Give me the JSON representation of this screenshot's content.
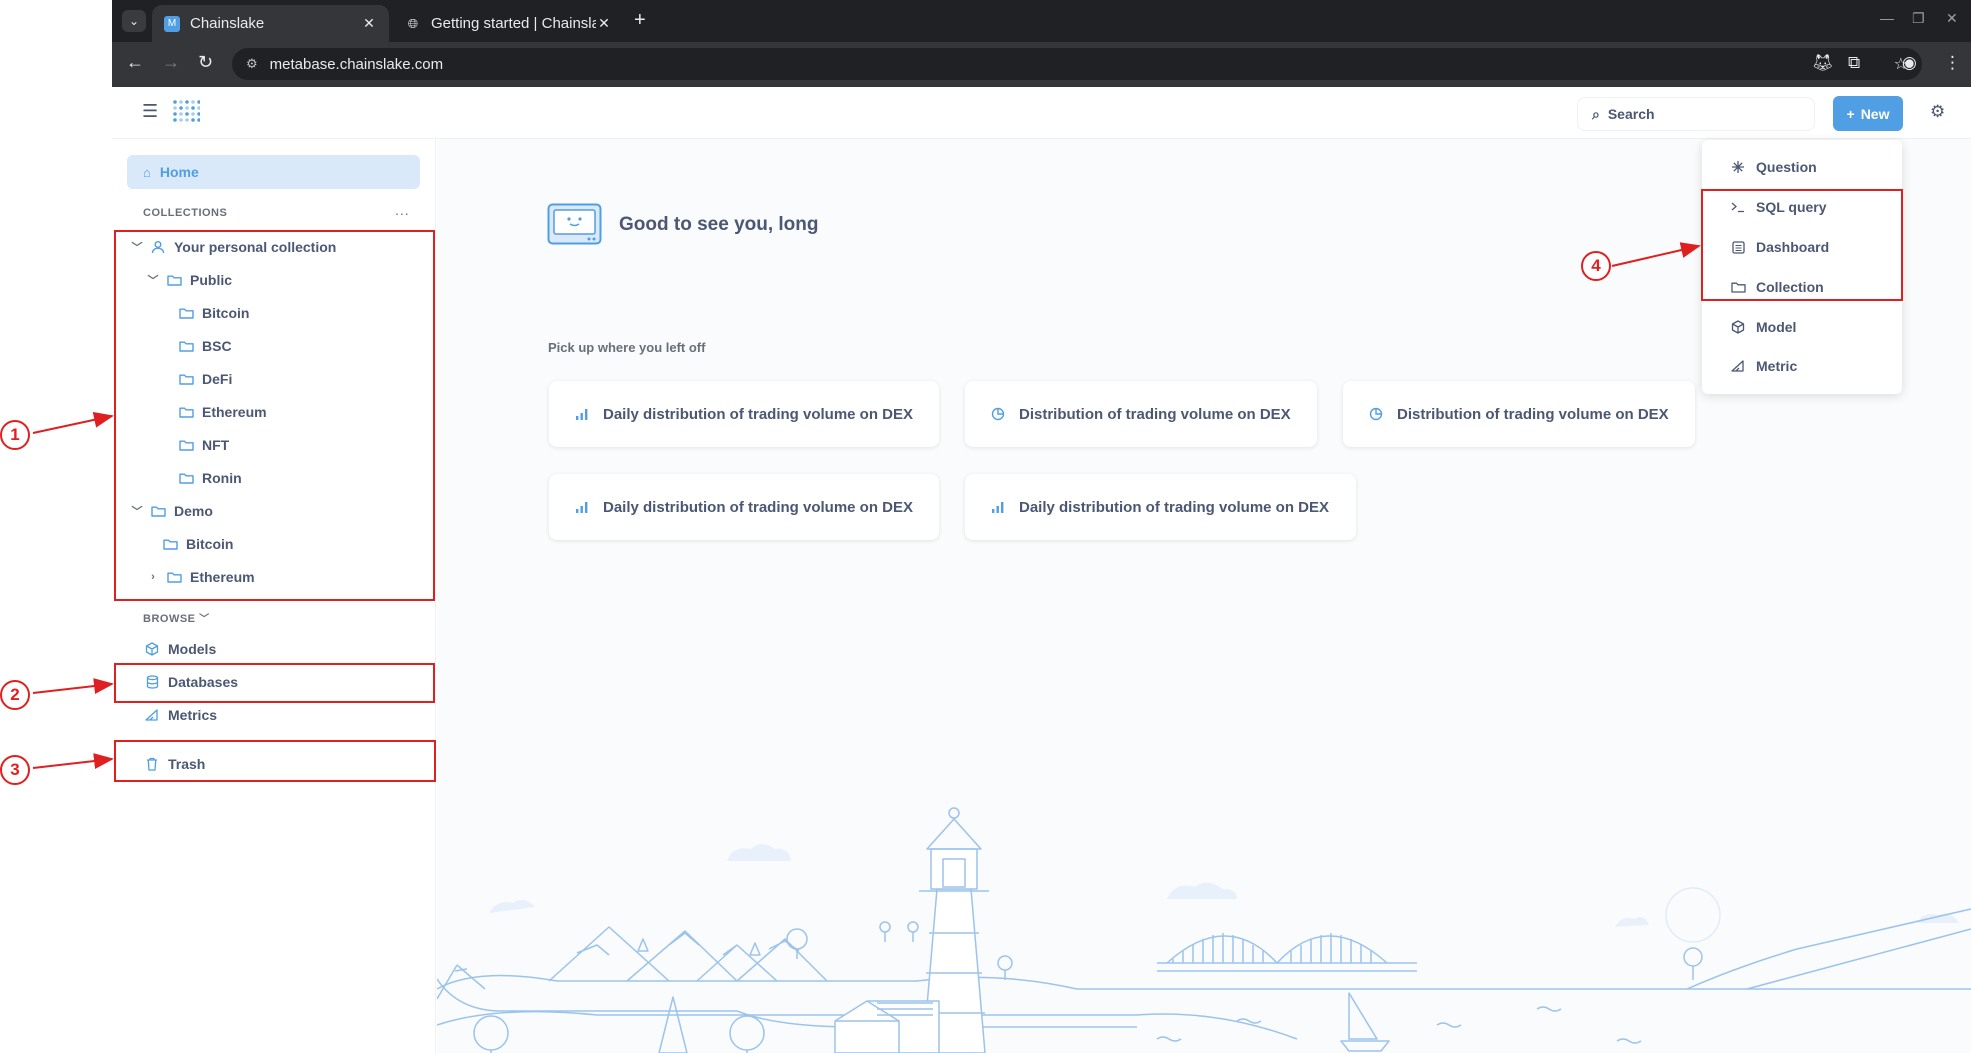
{
  "browser": {
    "tabs": [
      {
        "title": "Chainslake",
        "active": true
      },
      {
        "title": "Getting started | Chainslake",
        "active": false
      }
    ],
    "url": "metabase.chainslake.com"
  },
  "header": {
    "search_label": "Search",
    "new_label": "New"
  },
  "sidebar": {
    "home_label": "Home",
    "collections_label": "COLLECTIONS",
    "collections_more": "...",
    "tree": [
      {
        "label": "Your personal collection"
      },
      {
        "label": "Public"
      },
      {
        "label": "Bitcoin"
      },
      {
        "label": "BSC"
      },
      {
        "label": "DeFi"
      },
      {
        "label": "Ethereum"
      },
      {
        "label": "NFT"
      },
      {
        "label": "Ronin"
      },
      {
        "label": "Demo"
      },
      {
        "label": "Bitcoin"
      },
      {
        "label": "Ethereum"
      }
    ],
    "browse_label": "BROWSE",
    "browse_items": [
      {
        "label": "Models"
      },
      {
        "label": "Databases"
      },
      {
        "label": "Metrics"
      }
    ],
    "trash_label": "Trash"
  },
  "main": {
    "greeting": "Good to see you, long",
    "pickup_label": "Pick up where you left off",
    "cards": [
      {
        "label": "Daily distribution of trading volume on DEX",
        "icon": "bar-chart-icon"
      },
      {
        "label": "Distribution of trading volume on DEX",
        "icon": "pie-chart-icon"
      },
      {
        "label": "Distribution of trading volume on DEX",
        "icon": "pie-chart-icon"
      },
      {
        "label": "Daily distribution of trading volume on DEX",
        "icon": "bar-chart-icon"
      },
      {
        "label": "Daily distribution of trading volume on DEX",
        "icon": "bar-chart-icon"
      }
    ]
  },
  "new_menu": {
    "items": [
      {
        "label": "Question",
        "icon": "sparkle-icon"
      },
      {
        "label": "SQL query",
        "icon": "terminal-icon"
      },
      {
        "label": "Dashboard",
        "icon": "dashboard-icon"
      },
      {
        "label": "Collection",
        "icon": "folder-icon"
      },
      {
        "label": "Model",
        "icon": "cube-icon"
      },
      {
        "label": "Metric",
        "icon": "metric-icon"
      }
    ]
  },
  "annotations": [
    "1",
    "2",
    "3",
    "4"
  ],
  "colors": {
    "brand": "#509ee3",
    "brand_light": "#d9e9f9",
    "text": "#4c5773",
    "annotation": "#e02020",
    "chrome_dark": "#202124"
  }
}
